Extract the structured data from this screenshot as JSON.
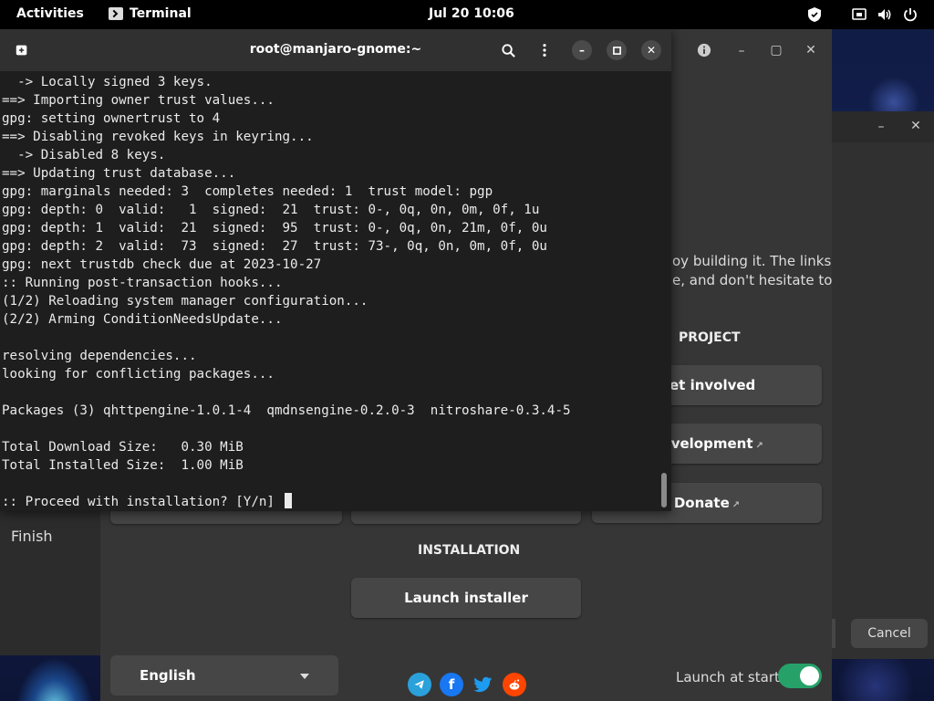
{
  "topbar": {
    "activities": "Activities",
    "app_name": "Terminal",
    "clock": "Jul 20  10:06"
  },
  "terminal": {
    "title": "root@manjaro-gnome:~",
    "lines": [
      "  -> Locally signed 3 keys.",
      "==> Importing owner trust values...",
      "gpg: setting ownertrust to 4",
      "==> Disabling revoked keys in keyring...",
      "  -> Disabled 8 keys.",
      "==> Updating trust database...",
      "gpg: marginals needed: 3  completes needed: 1  trust model: pgp",
      "gpg: depth: 0  valid:   1  signed:  21  trust: 0-, 0q, 0n, 0m, 0f, 1u",
      "gpg: depth: 1  valid:  21  signed:  95  trust: 0-, 0q, 0n, 21m, 0f, 0u",
      "gpg: depth: 2  valid:  73  signed:  27  trust: 73-, 0q, 0n, 0m, 0f, 0u",
      "gpg: next trustdb check due at 2023-10-27",
      ":: Running post-transaction hooks...",
      "(1/2) Reloading system manager configuration...",
      "(2/2) Arming ConditionNeedsUpdate...",
      "",
      "resolving dependencies...",
      "looking for conflicting packages...",
      "",
      "Packages (3) qhttpengine-1.0.1-4  qmdnsengine-0.2.0-3  nitroshare-0.3.4-5",
      "",
      "Total Download Size:   0.30 MiB",
      "Total Installed Size:  1.00 MiB",
      ""
    ],
    "prompt": ":: Proceed with installation? [Y/n] "
  },
  "welcome": {
    "body_line1": "oy building it. The links",
    "body_line2": "e, and don't hesitate to",
    "project_title": "PROJECT",
    "get_involved": "Get involved",
    "development": "Development",
    "donate": "Donate",
    "sidebar_finish": "Finish",
    "installation_title": "INSTALLATION",
    "launch_installer": "Launch installer",
    "language": "English",
    "launch_at_start": "Launch at start",
    "launch_at_start_on": true
  },
  "dialog": {
    "cancel": "Cancel"
  },
  "colors": {
    "accent_toggle": "#26a269",
    "telegram": "#2aa1da",
    "facebook": "#1877f2",
    "twitter": "#1d9bf0",
    "reddit": "#ff4500"
  },
  "icons": {
    "social": [
      "telegram-icon",
      "facebook-icon",
      "twitter-icon",
      "reddit-icon"
    ]
  }
}
